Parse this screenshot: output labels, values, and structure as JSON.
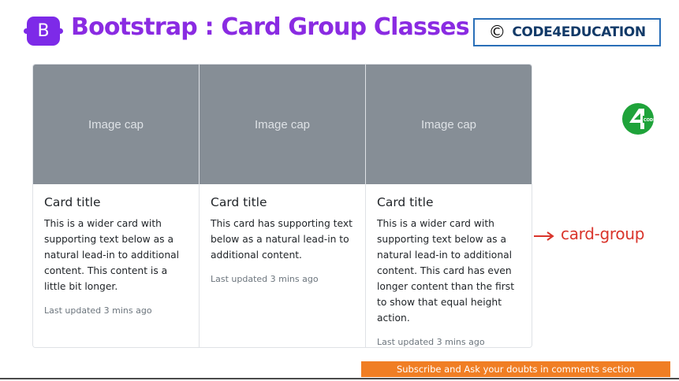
{
  "header": {
    "logo_letter": "B",
    "title": "Bootstrap : Card Group Classes",
    "brand_symbol": "©",
    "brand_name": "CODE4EDUCATION"
  },
  "cards": [
    {
      "image_cap": "Image cap",
      "title": "Card title",
      "text": "This is a wider card with supporting text below as a natural lead-in to additional content. This content is a little bit longer.",
      "footer": "Last updated 3 mins ago"
    },
    {
      "image_cap": "Image cap",
      "title": "Card title",
      "text": "This card has supporting text below as a natural lead-in to additional content.",
      "footer": "Last updated 3 mins ago"
    },
    {
      "image_cap": "Image cap",
      "title": "Card title",
      "text": "This is a wider card with supporting text below as a natural lead-in to additional content. This card has even longer content than the first to show that equal height action.",
      "footer": "Last updated 3 mins ago"
    }
  ],
  "annotation": {
    "label": "card-group",
    "icon": "arrow-right-icon",
    "color": "#d9342b"
  },
  "side_logo": {
    "icon": "code4education-logo-icon",
    "color": "#1fa33a"
  },
  "subscribe_bar": {
    "text": "Subscribe and Ask your doubts in comments section",
    "color": "#f07e24"
  },
  "colors": {
    "title": "#8a2be2",
    "logo_bg": "#7d2ae8",
    "image_cap_bg": "#868e96",
    "brand_border": "#2a6fb8"
  }
}
